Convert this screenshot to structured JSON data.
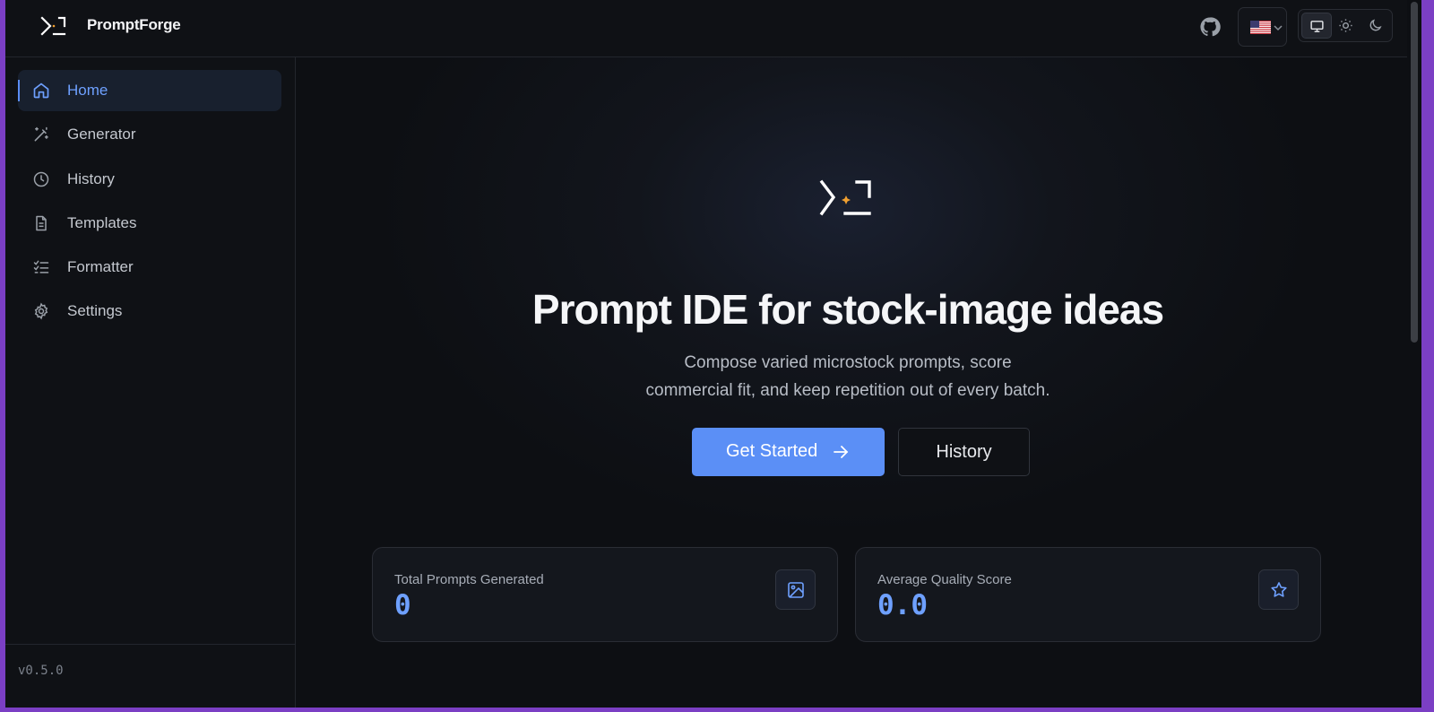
{
  "header": {
    "brand": "PromptForge",
    "icons": {
      "logo": "prompt-terminal-icon",
      "github": "github-icon",
      "language": "us-flag-icon"
    },
    "theme_options": [
      "system-monitor-icon",
      "sun-icon",
      "moon-icon"
    ],
    "theme_selected": "system"
  },
  "sidebar": {
    "items": [
      {
        "label": "Home",
        "icon": "home-icon",
        "active": true
      },
      {
        "label": "Generator",
        "icon": "magic-wand-icon",
        "active": false
      },
      {
        "label": "History",
        "icon": "clock-icon",
        "active": false
      },
      {
        "label": "Templates",
        "icon": "document-icon",
        "active": false
      },
      {
        "label": "Formatter",
        "icon": "checklist-icon",
        "active": false
      },
      {
        "label": "Settings",
        "icon": "gear-icon",
        "active": false
      }
    ],
    "version": "v0.5.0"
  },
  "hero": {
    "title": "Prompt IDE for stock-image ideas",
    "subtitle_line1": "Compose varied microstock prompts, score",
    "subtitle_line2": "commercial fit, and keep repetition out of every batch.",
    "primary_button": "Get Started",
    "secondary_button": "History"
  },
  "stats": [
    {
      "label": "Total Prompts Generated",
      "value": "0",
      "icon": "image-icon"
    },
    {
      "label": "Average Quality Score",
      "value": "0.0",
      "icon": "star-icon"
    }
  ],
  "colors": {
    "accent": "#5b8ff6",
    "accent_text": "#6ea0ff",
    "background": "#0d0f13",
    "logo_spark": "#f0a030"
  }
}
